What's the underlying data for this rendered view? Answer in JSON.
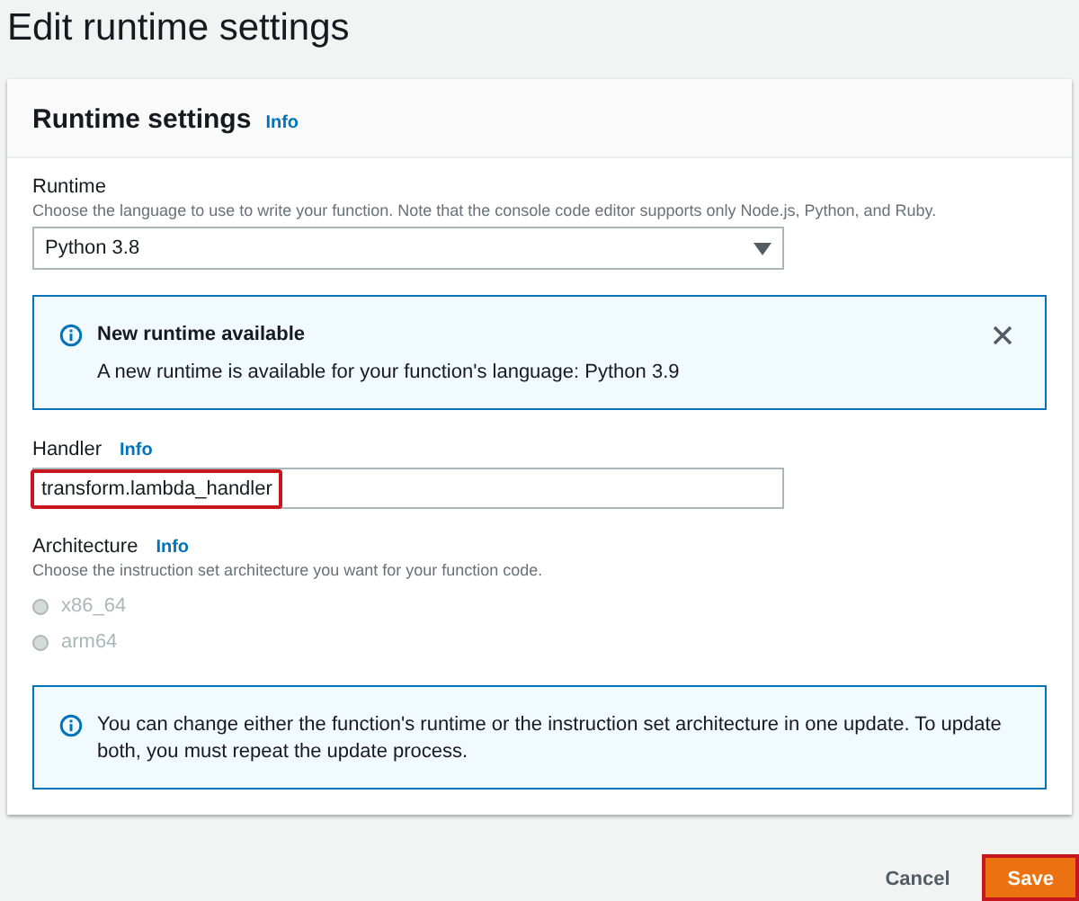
{
  "page_title": "Edit runtime settings",
  "panel": {
    "title": "Runtime settings",
    "info_link": "Info"
  },
  "runtime": {
    "label": "Runtime",
    "description": "Choose the language to use to write your function. Note that the console code editor supports only Node.js, Python, and Ruby.",
    "value": "Python 3.8"
  },
  "runtime_alert": {
    "title": "New runtime available",
    "message": "A new runtime is available for your function's language: Python 3.9",
    "dismissible": true
  },
  "handler": {
    "label": "Handler",
    "info_link": "Info",
    "value": "transform.lambda_handler",
    "annotated": true
  },
  "architecture": {
    "label": "Architecture",
    "info_link": "Info",
    "description": "Choose the instruction set architecture you want for your function code.",
    "options": [
      {
        "label": "x86_64",
        "selected": false,
        "disabled": true
      },
      {
        "label": "arm64",
        "selected": false,
        "disabled": true
      }
    ]
  },
  "architecture_note": {
    "message": "You can change either the function's runtime or the instruction set architecture in one update. To update both, you must repeat the update process."
  },
  "buttons": [
    {
      "label": "Cancel",
      "kind": "link",
      "annotated": false
    },
    {
      "label": "Save",
      "kind": "primary",
      "annotated": true
    }
  ]
}
